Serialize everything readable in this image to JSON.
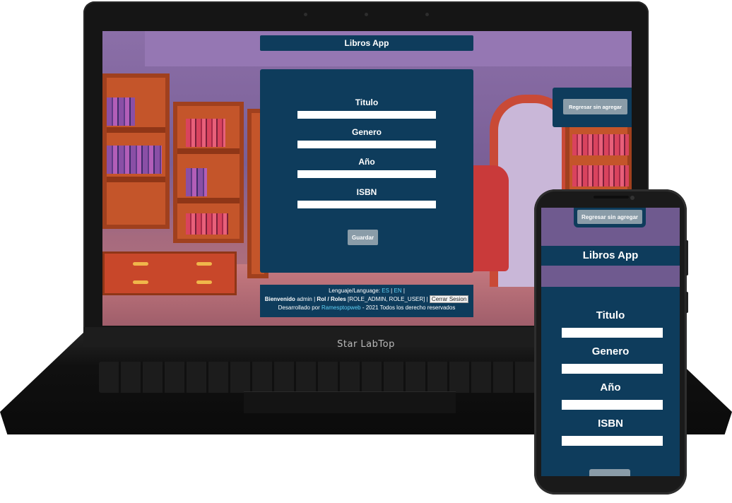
{
  "laptop": {
    "brand": "Star LabTop"
  },
  "app": {
    "title": "Libros App",
    "fields": [
      {
        "label": "Titulo",
        "value": ""
      },
      {
        "label": "Genero",
        "value": ""
      },
      {
        "label": "Año",
        "value": ""
      },
      {
        "label": "ISBN",
        "value": ""
      }
    ],
    "save_label": "Guardar",
    "back_label": "Regresar sin agregar",
    "footer": {
      "language_prefix": "Lenguaje/Language:",
      "lang_es": "ES",
      "sep1": "|",
      "lang_en": "EN",
      "sep2": "|",
      "welcome_label": "Bienvenido",
      "user": "admin",
      "sep3": "|",
      "roles_label": "Rol / Roles",
      "roles": "[ROLE_ADMIN, ROLE_USER]",
      "sep4": "|",
      "logout_label": "Cerrar Sesion",
      "dev_prefix": "Desarrollado por",
      "dev_name": "Ramesptopweb",
      "dev_suffix": "- 2021 Todos los derecho reservados"
    }
  },
  "colors": {
    "panel": "#0e3c5c",
    "button": "#8a9ca8",
    "link": "#5fd0f5"
  }
}
